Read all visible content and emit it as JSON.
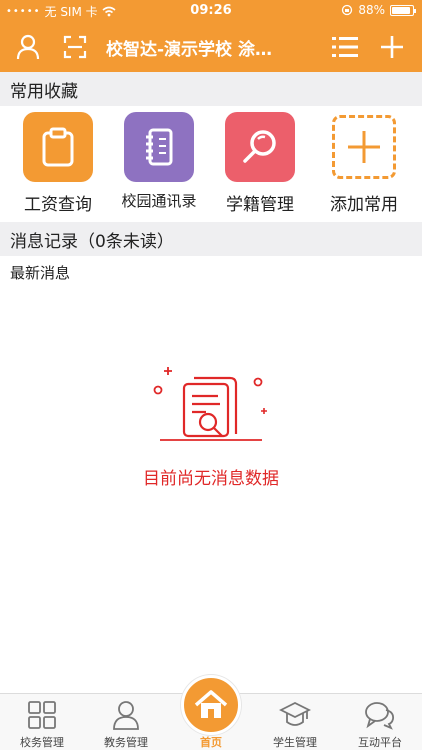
{
  "status_bar": {
    "carrier": "无 SIM 卡",
    "time": "09:26",
    "battery": "88%",
    "battery_level": 0.88
  },
  "header": {
    "title": "校智达-演示学校 涂…",
    "icons": [
      "user-icon",
      "scan-icon",
      "list-icon",
      "plus-icon"
    ]
  },
  "favorites": {
    "section_title": "常用收藏",
    "items": [
      {
        "label": "工资查询",
        "icon": "clipboard-icon",
        "color": "#f39a33"
      },
      {
        "label": "校园通讯录",
        "icon": "notebook-icon",
        "color": "#8e72c1"
      },
      {
        "label": "学籍管理",
        "icon": "magnifier-icon",
        "color": "#ec5f6b"
      },
      {
        "label": "添加常用",
        "icon": "add-icon",
        "color": "#f39a33"
      }
    ]
  },
  "messages": {
    "section_title": "消息记录（0条未读）",
    "sub_title": "最新消息",
    "empty_text": "目前尚无消息数据"
  },
  "tabbar": {
    "items": [
      {
        "label": "校务管理",
        "icon": "grid-icon"
      },
      {
        "label": "教务管理",
        "icon": "person-icon"
      },
      {
        "label": "首页",
        "icon": "home-icon",
        "active": true
      },
      {
        "label": "学生管理",
        "icon": "graduation-cap-icon"
      },
      {
        "label": "互动平台",
        "icon": "chat-icon"
      }
    ]
  },
  "colors": {
    "brand": "#f39a33",
    "alert": "#e02828"
  }
}
